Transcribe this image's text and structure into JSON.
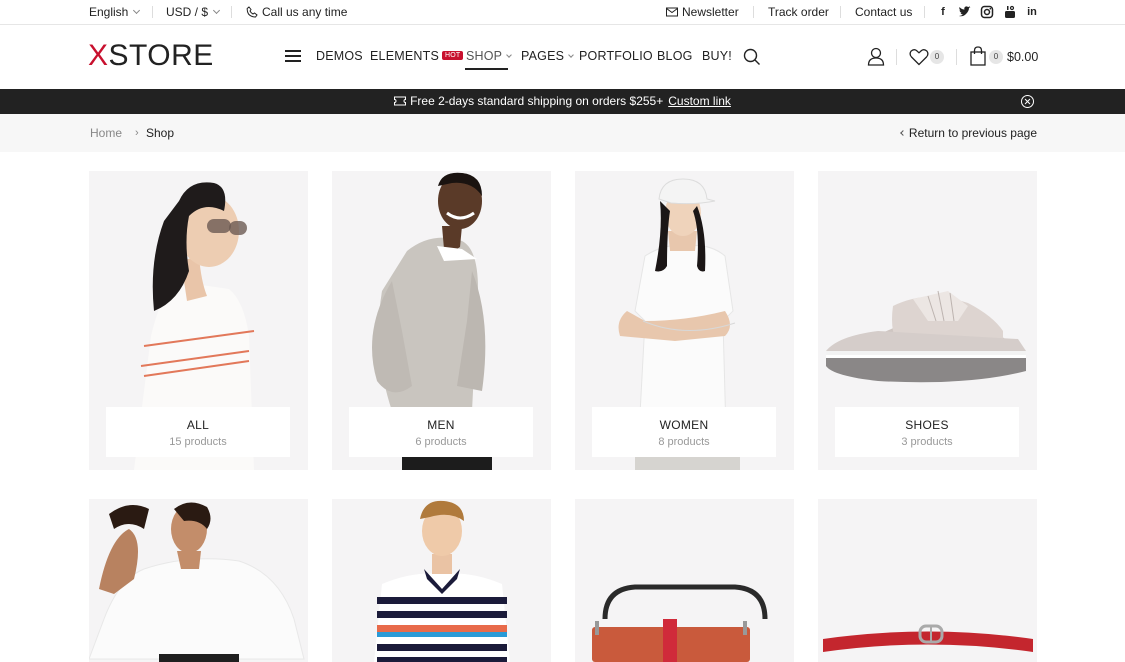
{
  "topbar": {
    "language": "English",
    "currency": "USD / $",
    "call": "Call us any time",
    "newsletter": "Newsletter",
    "track_order": "Track order",
    "contact": "Contact us",
    "social": [
      "facebook-icon",
      "twitter-icon",
      "instagram-icon",
      "youtube-icon",
      "linkedin-icon"
    ]
  },
  "header": {
    "logo_x": "X",
    "logo_rest": "STORE",
    "nav": [
      "DEMOS",
      "ELEMENTS",
      "SHOP",
      "PAGES",
      "PORTFOLIO",
      "BLOG",
      "BUY!"
    ],
    "hot_badge": "HOT",
    "wishlist_count": "0",
    "cart_count": "0",
    "cart_total": "$0.00"
  },
  "promo": {
    "text": "Free 2-days standard shipping on orders $255+",
    "link": "Custom link"
  },
  "breadcrumb": {
    "home": "Home",
    "current": "Shop",
    "back": "Return to previous page"
  },
  "categories": [
    {
      "title": "ALL",
      "count": "15 products"
    },
    {
      "title": "MEN",
      "count": "6 products"
    },
    {
      "title": "WOMEN",
      "count": "8 products"
    },
    {
      "title": "SHOES",
      "count": "3 products"
    }
  ],
  "colors": {
    "accent": "#c8102e",
    "promo_bg": "#222222",
    "card_bg": "#f5f4f5"
  }
}
